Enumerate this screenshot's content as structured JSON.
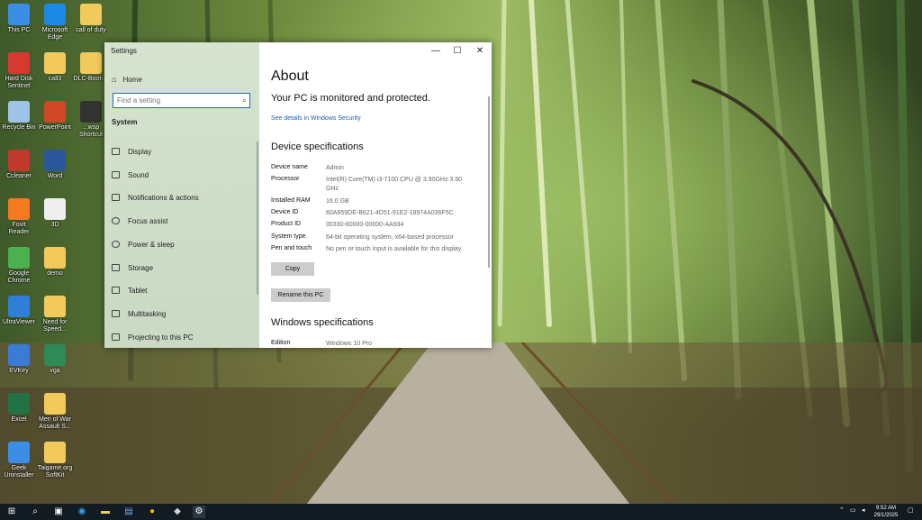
{
  "desktop": {
    "icons": [
      {
        "label": "This PC",
        "icon": "computer-icon",
        "color": "#3a8ee6"
      },
      {
        "label": "Microsoft Edge",
        "icon": "edge-icon",
        "color": "#1e88e5"
      },
      {
        "label": "call of duty",
        "icon": "folder-icon",
        "color": "#f2c95b"
      },
      {
        "label": "Hard Disk Sentinel",
        "icon": "hard-disk-icon",
        "color": "#d43a2f"
      },
      {
        "label": "call3",
        "icon": "folder-icon",
        "color": "#f2c95b"
      },
      {
        "label": "DLC-Boot-...",
        "icon": "folder-icon",
        "color": "#f2c95b"
      },
      {
        "label": "Recycle Bin",
        "icon": "recycle-bin-icon",
        "color": "#9fc3e6"
      },
      {
        "label": "PowerPoint",
        "icon": "powerpoint-icon",
        "color": "#d24726"
      },
      {
        "label": "...wsp Shortcut",
        "icon": "shortcut-icon",
        "color": "#333333"
      },
      {
        "label": "Ccleaner",
        "icon": "ccleaner-icon",
        "color": "#c0392b"
      },
      {
        "label": "Word",
        "icon": "word-icon",
        "color": "#2b579a"
      },
      {
        "label": "Foxit Reader",
        "icon": "foxit-icon",
        "color": "#f47920"
      },
      {
        "label": "3D",
        "icon": "file-icon",
        "color": "#eeeeee"
      },
      {
        "label": "Google Chrome",
        "icon": "chrome-icon",
        "color": "#4caf50"
      },
      {
        "label": "demo",
        "icon": "folder-icon",
        "color": "#f2c95b"
      },
      {
        "label": "UltraViewer",
        "icon": "ultraviewer-icon",
        "color": "#2f7fd8"
      },
      {
        "label": "Need for Speed...",
        "icon": "folder-icon",
        "color": "#f2c95b"
      },
      {
        "label": "EVKey",
        "icon": "evkey-icon",
        "color": "#3a7bd5"
      },
      {
        "label": "vga",
        "icon": "folder-icon",
        "color": "#2e8b57"
      },
      {
        "label": "Excel",
        "icon": "excel-icon",
        "color": "#217346"
      },
      {
        "label": "Men of War Assault S...",
        "icon": "game-icon",
        "color": "#f2c95b"
      },
      {
        "label": "Geek Uninstaller",
        "icon": "geek-uninstaller-icon",
        "color": "#3a8ee6"
      },
      {
        "label": "Taigame.org SoftKit",
        "icon": "folder-icon",
        "color": "#f2c95b"
      }
    ]
  },
  "settings": {
    "app_title": "Settings",
    "window_controls": {
      "minimize": "—",
      "maximize": "☐",
      "close": "✕"
    },
    "sidebar": {
      "home_label": "Home",
      "search_placeholder": "Find a setting",
      "section_title": "System",
      "items": [
        {
          "label": "Display",
          "icon": "display-icon"
        },
        {
          "label": "Sound",
          "icon": "sound-icon"
        },
        {
          "label": "Notifications & actions",
          "icon": "notifications-icon"
        },
        {
          "label": "Focus assist",
          "icon": "focus-assist-icon"
        },
        {
          "label": "Power & sleep",
          "icon": "power-icon"
        },
        {
          "label": "Storage",
          "icon": "storage-icon"
        },
        {
          "label": "Tablet",
          "icon": "tablet-icon"
        },
        {
          "label": "Multitasking",
          "icon": "multitasking-icon"
        },
        {
          "label": "Projecting to this PC",
          "icon": "projecting-icon"
        }
      ]
    },
    "content": {
      "title": "About",
      "protection_status": "Your PC is monitored and protected.",
      "security_link": "See details in Windows Security",
      "device_spec_title": "Device specifications",
      "device_specs": [
        {
          "key": "Device name",
          "value": "Admin"
        },
        {
          "key": "Processor",
          "value": "Intel(R) Core(TM) i3-7100 CPU @ 3.90GHz   3.90 GHz"
        },
        {
          "key": "Installed RAM",
          "value": "16.0 GB"
        },
        {
          "key": "Device ID",
          "value": "60A859DE-B621-4D51-91E2-18974A036F5C"
        },
        {
          "key": "Product ID",
          "value": "00330-80000-00000-AA934"
        },
        {
          "key": "System type",
          "value": "64-bit operating system, x64-based processor"
        },
        {
          "key": "Pen and touch",
          "value": "No pen or touch input is available for this display"
        }
      ],
      "copy_button": "Copy",
      "rename_button": "Rename this PC",
      "windows_spec_title": "Windows specifications",
      "windows_specs": [
        {
          "key": "Edition",
          "value": "Windows 10 Pro"
        }
      ]
    }
  },
  "taskbar": {
    "time": "9:52 AM",
    "date": "29/1/2025",
    "accent": "#121a22"
  }
}
